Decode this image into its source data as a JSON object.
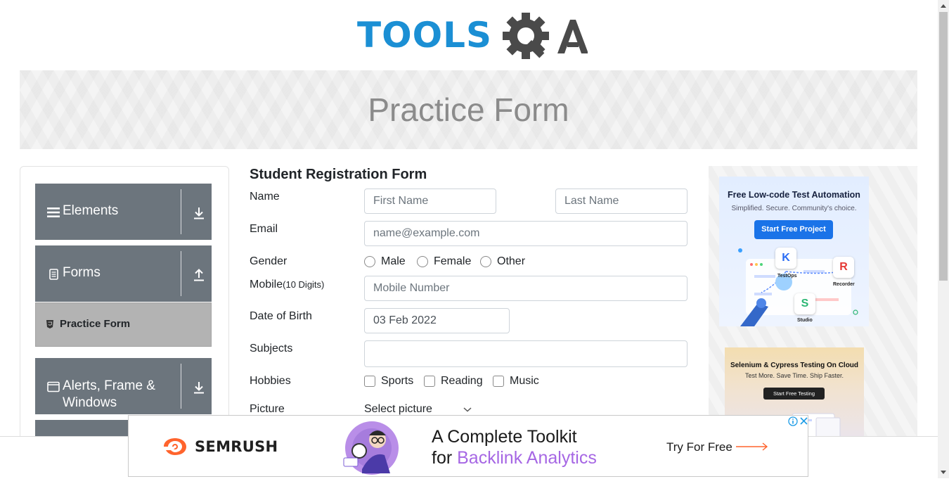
{
  "logo": {
    "text": "TOOLS",
    "suffix": "QA"
  },
  "banner": {
    "title": "Practice Form"
  },
  "sidebar": {
    "groups": [
      {
        "label": "Elements",
        "icon": "menu-lines-icon",
        "arrow": "download-arrow-icon"
      },
      {
        "label": "Forms",
        "icon": "document-icon",
        "arrow": "upload-arrow-icon"
      },
      {
        "label": "Alerts, Frame & Windows",
        "icon": "window-icon",
        "arrow": "download-arrow-icon"
      }
    ],
    "active_item": {
      "label": "Practice Form",
      "icon": "html5-shield-icon"
    }
  },
  "form": {
    "title": "Student Registration Form",
    "name_label": "Name",
    "first_name_placeholder": "First Name",
    "last_name_placeholder": "Last Name",
    "email_label": "Email",
    "email_placeholder": "name@example.com",
    "gender_label": "Gender",
    "genders": [
      "Male",
      "Female",
      "Other"
    ],
    "mobile_label": "Mobile",
    "mobile_hint": "(10 Digits)",
    "mobile_placeholder": "Mobile Number",
    "dob_label": "Date of Birth",
    "dob_value": "03 Feb 2022",
    "subjects_label": "Subjects",
    "subjects_value": "",
    "hobbies_label": "Hobbies",
    "hobbies": [
      "Sports",
      "Reading",
      "Music"
    ],
    "picture_label": "Picture",
    "picture_button": "Select picture"
  },
  "ads": {
    "katalon": {
      "headline": "Free Low-code Test Automation",
      "sub": "Simplified. Secure. Community's choice.",
      "cta": "Start Free Project",
      "tiles": [
        "TestOps",
        "Recorder",
        "Studio"
      ]
    },
    "selenium": {
      "headline": "Selenium & Cypress Testing On Cloud",
      "sub": "Test More. Save Time. Ship Faster.",
      "cta": "Start Free Testing"
    },
    "bottom": {
      "brand": "SEMRUSH",
      "line1": "A Complete Toolkit",
      "line2_prefix": "for ",
      "line2_highlight": "Backlink Analytics",
      "cta": "Try For Free"
    }
  },
  "colors": {
    "logo_blue": "#1b8fd4",
    "logo_gray": "#4a4a4a",
    "sidebar_group_bg": "#6c757d",
    "active_item_bg": "#b3b3b3",
    "katalon_button": "#1a73e8",
    "semrush_orange": "#ff642d",
    "highlight_purple": "#a667e4"
  }
}
